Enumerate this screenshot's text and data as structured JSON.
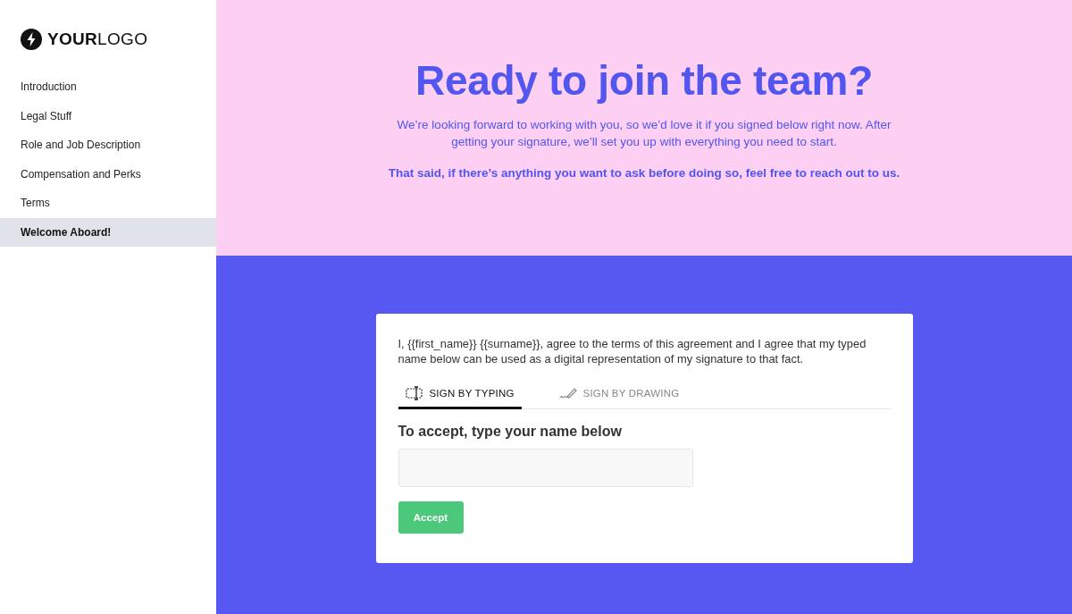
{
  "sidebar": {
    "logo": "**YOUR**LOGO",
    "items": [
      {
        "label": "Introduction",
        "selected": false
      },
      {
        "label": "Legal Stuff",
        "selected": false
      },
      {
        "label": "Role and Job Description",
        "selected": false
      },
      {
        "label": "Compensation and Perks",
        "selected": false
      },
      {
        "label": "Terms",
        "selected": false
      },
      {
        "label": "Welcome Aboard!",
        "selected": true
      }
    ]
  },
  "hero": {
    "title": "Ready to join the team?",
    "intro": "We’re looking forward to working with you, so we’d love it if you signed below right now. After getting your signature, we’ll set you up with everything you need to start.",
    "note": "That said, if there’s anything you want to ask before doing so, feel free to reach out to us."
  },
  "signature_card": {
    "agreement": "I, {{first_name}} {{surname}}, agree to the terms of this agreement and I agree that my typed name below can be used as a digital representation of my signature to that fact.",
    "tabs": [
      {
        "label": "SIGN BY TYPING",
        "kind": "typing",
        "selected": true
      },
      {
        "label": "SIGN BY DRAWING",
        "kind": "drawing",
        "selected": false
      }
    ],
    "prompt": "To accept, type your name below",
    "button": "Accept"
  }
}
